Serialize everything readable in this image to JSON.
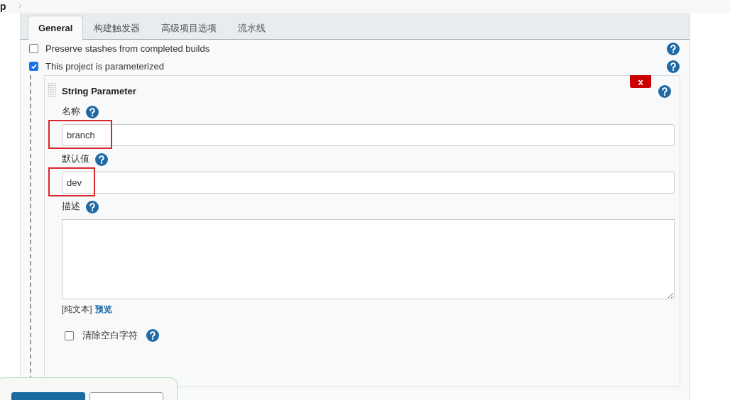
{
  "breadcrumb": {
    "text": "p"
  },
  "tabs": [
    {
      "label": "General",
      "selected": true
    },
    {
      "label": "构建触发器",
      "selected": false
    },
    {
      "label": "高级项目选项",
      "selected": false
    },
    {
      "label": "流水线",
      "selected": false
    }
  ],
  "options": [
    {
      "label": "Preserve stashes from completed builds",
      "checked": false
    },
    {
      "label": "This project is parameterized",
      "checked": true
    }
  ],
  "parameter": {
    "title": "String Parameter",
    "delete_label": "x",
    "fields": [
      {
        "kind": "text",
        "label": "名称",
        "value": "branch",
        "highlighted": true
      },
      {
        "kind": "text",
        "label": "默认值",
        "value": "dev",
        "highlighted": true
      },
      {
        "kind": "textarea",
        "label": "描述",
        "highlighted": false
      }
    ],
    "format": {
      "text": "[纯文本]",
      "link": "预览"
    },
    "trim": {
      "label": "清除空白字符",
      "checked": false
    }
  },
  "footer_buttons": [
    {
      "kind": "primary"
    },
    {
      "kind": "secondary"
    }
  ]
}
